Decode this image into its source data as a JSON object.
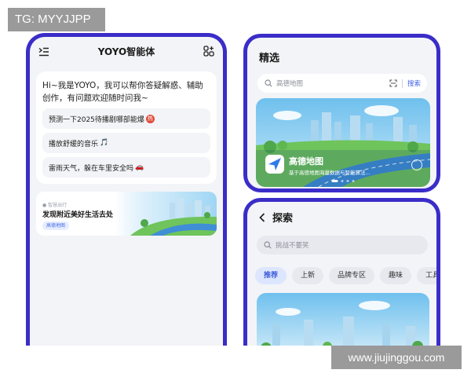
{
  "watermarks": {
    "top_left": "TG: MYYJJPP",
    "bottom_right": "www.jiujinggou.com"
  },
  "left_phone": {
    "title": "YOYO智能体",
    "greeting": "Hi~我是YOYO，我可以帮你答疑解惑、辅助创作，有问题欢迎随时问我~",
    "suggestions": [
      {
        "text": "预测一下2025待播剧哪部能爆",
        "badge": "热"
      },
      {
        "text": "播放舒缓的音乐",
        "icon": "🎵"
      },
      {
        "text": "雷雨天气，躲在车里安全吗",
        "icon": "🚗"
      }
    ],
    "promo": {
      "small_text": "● 智慧出行",
      "main_text": "发现附近美好生活去处",
      "chip": "高德地图"
    }
  },
  "top_right_phone": {
    "title": "精选",
    "search_placeholder": "高德地图",
    "search_button": "搜索",
    "banner": {
      "title": "高德地图",
      "subtitle": "基于高德地图海量数据与智能算法..."
    }
  },
  "bottom_right_phone": {
    "title": "探索",
    "search_placeholder": "挑战不要笑",
    "pills": [
      "推荐",
      "上新",
      "品牌专区",
      "趣味",
      "工具"
    ]
  },
  "colors": {
    "frame": "#3a2dc8",
    "accent": "#3f63e6",
    "screen_bg": "#f3f4f7",
    "sky": "#8fcdf0",
    "grass": "#6fc45c",
    "road": "#3f8ed6"
  }
}
